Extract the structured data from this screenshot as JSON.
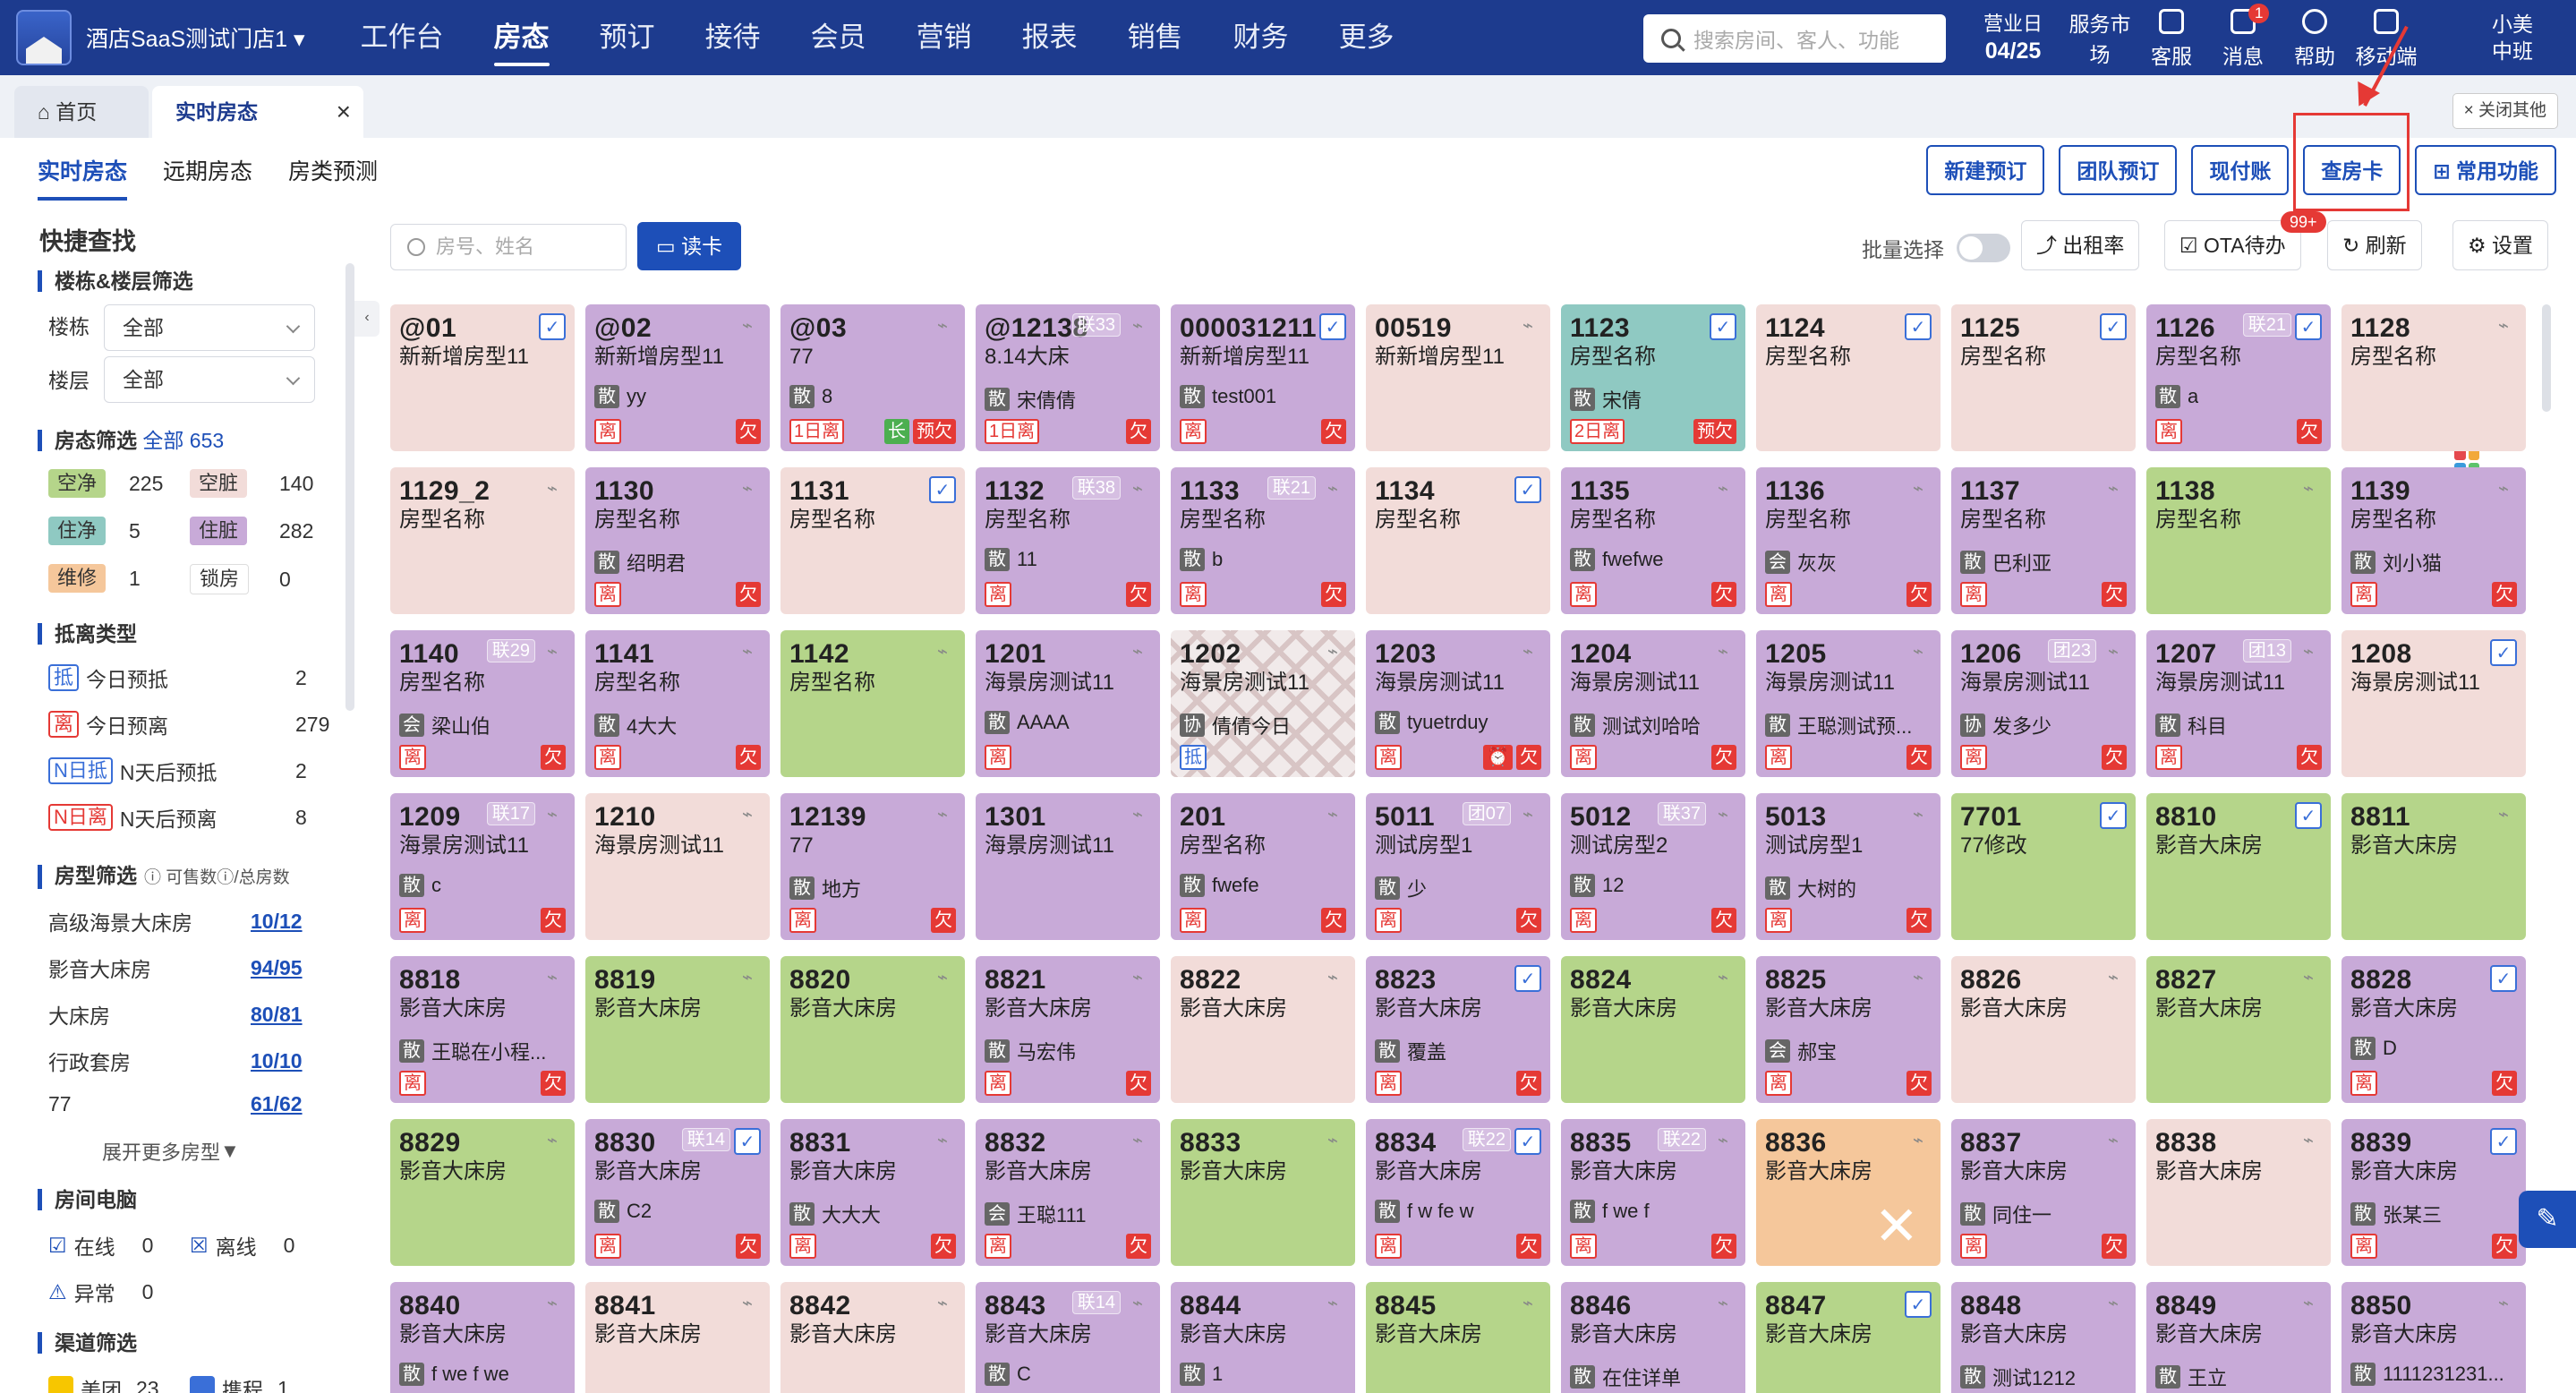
{
  "nav": {
    "store": "酒店SaaS测试门店1",
    "items": [
      "工作台",
      "房态",
      "预订",
      "接待",
      "会员",
      "营销",
      "报表",
      "销售",
      "财务",
      "更多"
    ],
    "active_index": 1,
    "search_placeholder": "搜索房间、客人、功能",
    "bizday_label": "营业日",
    "bizday": "04/25",
    "icons": [
      {
        "label": "服务市场",
        "icon": "grid-icon"
      },
      {
        "label": "客服",
        "icon": "headset-icon"
      },
      {
        "label": "消息",
        "icon": "mail-icon",
        "badge": "1"
      },
      {
        "label": "帮助",
        "icon": "help-icon"
      },
      {
        "label": "移动端",
        "icon": "mobile-icon"
      }
    ],
    "user_name": "小美",
    "user_shift": "中班"
  },
  "tabs": {
    "home": "首页",
    "current": "实时房态",
    "close_others": "关闭其他"
  },
  "subtabs": [
    "实时房态",
    "远期房态",
    "房类预测"
  ],
  "actions": [
    "新建预订",
    "团队预订",
    "现付账",
    "查房卡",
    "常用功能"
  ],
  "actions_badge": "99+",
  "sidebar": {
    "title": "快捷查找",
    "building_section": "楼栋&楼层筛选",
    "building_label": "楼栋",
    "building_value": "全部",
    "floor_label": "楼层",
    "floor_value": "全部",
    "status_section": "房态筛选",
    "status_all": "全部 653",
    "status": [
      {
        "label": "空净",
        "count": "225",
        "color": "#b5d58a"
      },
      {
        "label": "空脏",
        "count": "140",
        "color": "#f2dcd9"
      },
      {
        "label": "住净",
        "count": "5",
        "color": "#8fc9c2"
      },
      {
        "label": "住脏",
        "count": "282",
        "color": "#c8aad8"
      },
      {
        "label": "维修",
        "count": "1",
        "color": "#f5c79b"
      },
      {
        "label": "锁房",
        "count": "0",
        "color": "#ffffff"
      }
    ],
    "arrival_section": "抵离类型",
    "arrival": [
      {
        "tag": "抵",
        "label": "今日预抵",
        "count": "2"
      },
      {
        "tag": "离",
        "label": "今日预离",
        "count": "279"
      },
      {
        "tag": "N日抵",
        "label": "N天后预抵",
        "count": "2"
      },
      {
        "tag": "N日离",
        "label": "N天后预离",
        "count": "8"
      }
    ],
    "roomtype_section": "房型筛选",
    "roomtype_hint": "可售数",
    "roomtype_hint2": "/总房数",
    "roomtypes": [
      {
        "name": "高级海景大床房",
        "avail": "10/12"
      },
      {
        "name": "影音大床房",
        "avail": "94/95"
      },
      {
        "name": "大床房",
        "avail": "80/81"
      },
      {
        "name": "行政套房",
        "avail": "10/10"
      },
      {
        "name": "77",
        "avail": "61/62"
      }
    ],
    "expand_more": "展开更多房型",
    "pc_section": "房间电脑",
    "pc": [
      {
        "label": "在线",
        "count": "0"
      },
      {
        "label": "离线",
        "count": "0"
      },
      {
        "label": "异常",
        "count": "0"
      }
    ],
    "channel_section": "渠道筛选",
    "channels": [
      {
        "label": "美团",
        "count": "23"
      },
      {
        "label": "携程",
        "count": "1"
      }
    ]
  },
  "filters": {
    "search_placeholder": "房号、姓名",
    "read_card": "读卡",
    "batch_select": "批量选择",
    "occupancy": "出租率",
    "ota_pending": "OTA待办",
    "refresh": "刷新",
    "settings": "设置"
  },
  "rooms": [
    {
      "no": "@01",
      "type": "新新增房型11",
      "color": "pink",
      "icon": "blue"
    },
    {
      "no": "@02",
      "type": "新新增房型11",
      "color": "purple",
      "icon": "gray",
      "gtag": "散",
      "guest": "yy",
      "bl": [
        "离"
      ],
      "br": [
        "欠"
      ]
    },
    {
      "no": "@03",
      "type": "77",
      "color": "purple",
      "icon": "gray",
      "gtag": "散",
      "guest": "8",
      "bl": [
        "1日离"
      ],
      "br": [
        "长|g",
        "预欠"
      ]
    },
    {
      "no": "@12138",
      "type": "8.14大床",
      "color": "purple",
      "grp": "联33",
      "icon": "gray",
      "gtag": "散",
      "guest": "宋倩倩",
      "bl": [
        "1日离"
      ],
      "br": [
        "欠"
      ]
    },
    {
      "no": "000031211",
      "type": "新新增房型11",
      "color": "purple",
      "icon": "blue",
      "gtag": "散",
      "guest": "test001",
      "bl": [
        "离"
      ],
      "br": [
        "欠"
      ]
    },
    {
      "no": "00519",
      "type": "新新增房型11",
      "color": "pink",
      "icon": "gray"
    },
    {
      "no": "1123",
      "type": "房型名称",
      "color": "teal",
      "icon": "blue",
      "gtag": "散",
      "guest": "宋倩",
      "bl": [
        "2日离"
      ],
      "br": [
        "预欠"
      ]
    },
    {
      "no": "1124",
      "type": "房型名称",
      "color": "pink",
      "icon": "blue"
    },
    {
      "no": "1125",
      "type": "房型名称",
      "color": "pink",
      "icon": "blue"
    },
    {
      "no": "1126",
      "type": "房型名称",
      "color": "purple",
      "grp": "联21",
      "icon": "blue",
      "gtag": "散",
      "guest": "a",
      "bl": [
        "离"
      ],
      "br": [
        "欠"
      ]
    },
    {
      "no": "1128",
      "type": "房型名称",
      "color": "pink",
      "icon": "gray"
    },
    {
      "no": "1129_2",
      "type": "房型名称",
      "color": "pink",
      "icon": "gray"
    },
    {
      "no": "1130",
      "type": "房型名称",
      "color": "purple",
      "icon": "gray",
      "gtag": "散",
      "guest": "绍明君",
      "bl": [
        "离"
      ],
      "br": [
        "欠"
      ]
    },
    {
      "no": "1131",
      "type": "房型名称",
      "color": "pink",
      "icon": "blue"
    },
    {
      "no": "1132",
      "type": "房型名称",
      "color": "purple",
      "grp": "联38",
      "icon": "gray",
      "gtag": "散",
      "guest": "11",
      "bl": [
        "离"
      ],
      "br": [
        "欠"
      ]
    },
    {
      "no": "1133",
      "type": "房型名称",
      "color": "purple",
      "grp": "联21",
      "icon": "gray",
      "gtag": "散",
      "guest": "b",
      "bl": [
        "离"
      ],
      "br": [
        "欠"
      ]
    },
    {
      "no": "1134",
      "type": "房型名称",
      "color": "pink",
      "icon": "blue"
    },
    {
      "no": "1135",
      "type": "房型名称",
      "color": "purple",
      "icon": "gray",
      "gtag": "散",
      "guest": "fwefwe",
      "bl": [
        "离"
      ],
      "br": [
        "欠"
      ]
    },
    {
      "no": "1136",
      "type": "房型名称",
      "color": "purple",
      "icon": "gray",
      "gtag": "会",
      "guest": "灰灰",
      "bl": [
        "离"
      ],
      "br": [
        "欠"
      ]
    },
    {
      "no": "1137",
      "type": "房型名称",
      "color": "purple",
      "icon": "gray",
      "gtag": "散",
      "guest": "巴利亚",
      "bl": [
        "离"
      ],
      "br": [
        "欠"
      ]
    },
    {
      "no": "1138",
      "type": "房型名称",
      "color": "green",
      "icon": "gray"
    },
    {
      "no": "1139",
      "type": "房型名称",
      "color": "purple",
      "icon": "gray",
      "gtag": "散",
      "guest": "刘小猫",
      "bl": [
        "离"
      ],
      "br": [
        "欠"
      ]
    },
    {
      "no": "1140",
      "type": "房型名称",
      "color": "purple",
      "grp": "联29",
      "icon": "gray",
      "gtag": "会",
      "guest": "梁山伯",
      "bl": [
        "离"
      ],
      "br": [
        "欠"
      ]
    },
    {
      "no": "1141",
      "type": "房型名称",
      "color": "purple",
      "icon": "gray",
      "gtag": "散",
      "guest": "4大大",
      "bl": [
        "离"
      ],
      "br": [
        "欠"
      ]
    },
    {
      "no": "1142",
      "type": "房型名称",
      "color": "green",
      "icon": "gray"
    },
    {
      "no": "1201",
      "type": "海景房测试11",
      "color": "purple",
      "icon": "gray",
      "gtag": "散",
      "guest": "AAAA",
      "bl": [
        "离"
      ]
    },
    {
      "no": "1202",
      "type": "海景房测试11",
      "color": "check",
      "icon": "gray",
      "gtag": "协",
      "guest": "倩倩今日",
      "bl": [
        "抵|b"
      ]
    },
    {
      "no": "1203",
      "type": "海景房测试11",
      "color": "purple",
      "icon": "gray",
      "gtag": "散",
      "guest": "tyuetrduy",
      "bl": [
        "离"
      ],
      "br": [
        "⏰",
        "欠"
      ]
    },
    {
      "no": "1204",
      "type": "海景房测试11",
      "color": "purple",
      "icon": "gray",
      "gtag": "散",
      "guest": "测试刘哈哈",
      "bl": [
        "离"
      ],
      "br": [
        "欠"
      ]
    },
    {
      "no": "1205",
      "type": "海景房测试11",
      "color": "purple",
      "icon": "gray",
      "gtag": "散",
      "guest": "王聪测试预...",
      "bl": [
        "离"
      ],
      "br": [
        "欠"
      ]
    },
    {
      "no": "1206",
      "type": "海景房测试11",
      "color": "purple",
      "grp": "团23",
      "icon": "gray",
      "gtag": "协",
      "guest": "发多少",
      "bl": [
        "离"
      ],
      "br": [
        "欠"
      ]
    },
    {
      "no": "1207",
      "type": "海景房测试11",
      "color": "purple",
      "grp": "团13",
      "icon": "gray",
      "gtag": "散",
      "guest": "科目",
      "bl": [
        "离"
      ],
      "br": [
        "欠"
      ]
    },
    {
      "no": "1208",
      "type": "海景房测试11",
      "color": "pink",
      "icon": "blue"
    },
    {
      "no": "1209",
      "type": "海景房测试11",
      "color": "purple",
      "grp": "联17",
      "icon": "gray",
      "gtag": "散",
      "guest": "c",
      "bl": [
        "离"
      ],
      "br": [
        "欠"
      ]
    },
    {
      "no": "1210",
      "type": "海景房测试11",
      "color": "pink",
      "icon": "gray"
    },
    {
      "no": "12139",
      "type": "77",
      "color": "purple",
      "icon": "gray",
      "gtag": "散",
      "guest": "地方",
      "bl": [
        "离"
      ],
      "br": [
        "欠"
      ]
    },
    {
      "no": "1301",
      "type": "海景房测试11",
      "color": "purple",
      "icon": "gray"
    },
    {
      "no": "201",
      "type": "房型名称",
      "color": "purple",
      "icon": "gray",
      "gtag": "散",
      "guest": "fwefe",
      "bl": [
        "离"
      ],
      "br": [
        "欠"
      ]
    },
    {
      "no": "5011",
      "type": "测试房型1",
      "color": "purple",
      "grp": "团07",
      "icon": "gray",
      "gtag": "散",
      "guest": "少",
      "bl": [
        "离"
      ],
      "br": [
        "欠"
      ]
    },
    {
      "no": "5012",
      "type": "测试房型2",
      "color": "purple",
      "grp": "联37",
      "icon": "gray",
      "gtag": "散",
      "guest": "12",
      "bl": [
        "离"
      ],
      "br": [
        "欠"
      ]
    },
    {
      "no": "5013",
      "type": "测试房型1",
      "color": "purple",
      "icon": "gray",
      "gtag": "散",
      "guest": "大树的",
      "bl": [
        "离"
      ],
      "br": [
        "欠"
      ]
    },
    {
      "no": "7701",
      "type": "77修改",
      "color": "green",
      "icon": "blue"
    },
    {
      "no": "8810",
      "type": "影音大床房",
      "color": "green",
      "icon": "blue"
    },
    {
      "no": "8811",
      "type": "影音大床房",
      "color": "green",
      "icon": "gray"
    },
    {
      "no": "8818",
      "type": "影音大床房",
      "color": "purple",
      "icon": "gray",
      "gtag": "散",
      "guest": "王聪在小程...",
      "bl": [
        "离"
      ],
      "br": [
        "欠"
      ]
    },
    {
      "no": "8819",
      "type": "影音大床房",
      "color": "green",
      "icon": "gray"
    },
    {
      "no": "8820",
      "type": "影音大床房",
      "color": "green",
      "icon": "gray"
    },
    {
      "no": "8821",
      "type": "影音大床房",
      "color": "purple",
      "icon": "gray",
      "gtag": "散",
      "guest": "马宏伟",
      "bl": [
        "离"
      ],
      "br": [
        "欠"
      ]
    },
    {
      "no": "8822",
      "type": "影音大床房",
      "color": "pink",
      "icon": "gray"
    },
    {
      "no": "8823",
      "type": "影音大床房",
      "color": "purple",
      "icon": "blue",
      "gtag": "散",
      "guest": "覆盖",
      "bl": [
        "离"
      ],
      "br": [
        "欠"
      ]
    },
    {
      "no": "8824",
      "type": "影音大床房",
      "color": "green",
      "icon": "gray"
    },
    {
      "no": "8825",
      "type": "影音大床房",
      "color": "purple",
      "icon": "gray",
      "gtag": "会",
      "guest": "郝宝",
      "bl": [
        "离"
      ],
      "br": [
        "欠"
      ]
    },
    {
      "no": "8826",
      "type": "影音大床房",
      "color": "pink",
      "icon": "gray"
    },
    {
      "no": "8827",
      "type": "影音大床房",
      "color": "green",
      "icon": "gray"
    },
    {
      "no": "8828",
      "type": "影音大床房",
      "color": "purple",
      "icon": "blue",
      "gtag": "散",
      "guest": "D",
      "bl": [
        "离"
      ],
      "br": [
        "欠"
      ]
    },
    {
      "no": "8829",
      "type": "影音大床房",
      "color": "green",
      "icon": "gray"
    },
    {
      "no": "8830",
      "type": "影音大床房",
      "color": "purple",
      "grp": "联14",
      "icon": "blue",
      "gtag": "散",
      "guest": "C2",
      "bl": [
        "离"
      ],
      "br": [
        "欠"
      ]
    },
    {
      "no": "8831",
      "type": "影音大床房",
      "color": "purple",
      "icon": "gray",
      "gtag": "散",
      "guest": "大大大",
      "bl": [
        "离"
      ],
      "br": [
        "欠"
      ]
    },
    {
      "no": "8832",
      "type": "影音大床房",
      "color": "purple",
      "icon": "gray",
      "gtag": "会",
      "guest": "王聪111",
      "bl": [
        "离"
      ],
      "br": [
        "欠"
      ]
    },
    {
      "no": "8833",
      "type": "影音大床房",
      "color": "green",
      "icon": "gray"
    },
    {
      "no": "8834",
      "type": "影音大床房",
      "color": "purple",
      "grp": "联22",
      "icon": "blue",
      "gtag": "散",
      "guest": "f w fe w",
      "bl": [
        "离"
      ],
      "br": [
        "欠"
      ]
    },
    {
      "no": "8835",
      "type": "影音大床房",
      "color": "purple",
      "grp": "联22",
      "icon": "gray",
      "gtag": "散",
      "guest": "f we f",
      "bl": [
        "离"
      ],
      "br": [
        "欠"
      ]
    },
    {
      "no": "8836",
      "type": "影音大床房",
      "color": "orange",
      "icon": "gray",
      "tool": true
    },
    {
      "no": "8837",
      "type": "影音大床房",
      "color": "purple",
      "icon": "gray",
      "gtag": "散",
      "guest": "同住一",
      "bl": [
        "离"
      ],
      "br": [
        "欠"
      ]
    },
    {
      "no": "8838",
      "type": "影音大床房",
      "color": "pink",
      "icon": "gray"
    },
    {
      "no": "8839",
      "type": "影音大床房",
      "color": "purple",
      "icon": "blue",
      "gtag": "散",
      "guest": "张某三",
      "bl": [
        "离"
      ],
      "br": [
        "欠"
      ]
    },
    {
      "no": "8840",
      "type": "影音大床房",
      "color": "purple",
      "icon": "gray",
      "gtag": "散",
      "guest": "f we f we"
    },
    {
      "no": "8841",
      "type": "影音大床房",
      "color": "pink",
      "icon": "gray"
    },
    {
      "no": "8842",
      "type": "影音大床房",
      "color": "pink",
      "icon": "gray"
    },
    {
      "no": "8843",
      "type": "影音大床房",
      "color": "purple",
      "grp": "联14",
      "icon": "gray",
      "gtag": "散",
      "guest": "C"
    },
    {
      "no": "8844",
      "type": "影音大床房",
      "color": "purple",
      "icon": "gray",
      "gtag": "散",
      "guest": "1"
    },
    {
      "no": "8845",
      "type": "影音大床房",
      "color": "green",
      "icon": "gray"
    },
    {
      "no": "8846",
      "type": "影音大床房",
      "color": "purple",
      "icon": "gray",
      "gtag": "散",
      "guest": "在住详单"
    },
    {
      "no": "8847",
      "type": "影音大床房",
      "color": "green",
      "icon": "blue"
    },
    {
      "no": "8848",
      "type": "影音大床房",
      "color": "purple",
      "icon": "gray",
      "gtag": "散",
      "guest": "测试1212"
    },
    {
      "no": "8849",
      "type": "影音大床房",
      "color": "purple",
      "icon": "gray",
      "gtag": "散",
      "guest": "王立"
    },
    {
      "no": "8850",
      "type": "影音大床房",
      "color": "purple",
      "icon": "gray",
      "gtag": "散",
      "guest": "1111231231..."
    }
  ]
}
